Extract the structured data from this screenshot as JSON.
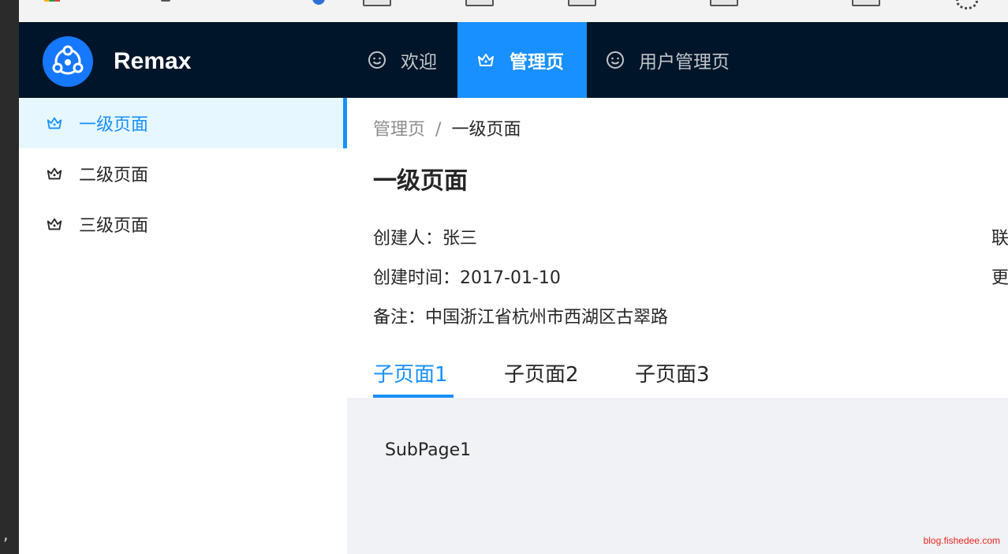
{
  "app": {
    "name": "Remax"
  },
  "top_nav": [
    {
      "label": "欢迎",
      "icon": "smile-icon",
      "active": false
    },
    {
      "label": "管理页",
      "icon": "crown-icon",
      "active": true
    },
    {
      "label": "用户管理页",
      "icon": "smile-icon",
      "active": false
    }
  ],
  "sidebar": {
    "items": [
      {
        "label": "一级页面",
        "icon": "crown-icon",
        "active": true
      },
      {
        "label": "二级页面",
        "icon": "crown-icon",
        "active": false
      },
      {
        "label": "三级页面",
        "icon": "crown-icon",
        "active": false
      }
    ]
  },
  "breadcrumb": {
    "parent": "管理页",
    "separator": "/",
    "current": "一级页面"
  },
  "page": {
    "title": "一级页面",
    "descriptions": [
      {
        "label": "创建人：",
        "value": "张三"
      },
      {
        "label": "创建时间：",
        "value": "2017-01-10"
      },
      {
        "label": "备注：",
        "value": "中国浙江省杭州市西湖区古翠路"
      }
    ],
    "right_column_clipped": [
      "联",
      "更"
    ]
  },
  "tabs": [
    {
      "label": "子页面1",
      "active": true
    },
    {
      "label": "子页面2",
      "active": false
    },
    {
      "label": "子页面3",
      "active": false
    }
  ],
  "tab_content": "SubPage1",
  "watermark": "blog.fishedee.com",
  "outer_left_glyph": ",",
  "colors": {
    "primary": "#1890ff",
    "header_bg": "#001529",
    "content_bg": "#f0f2f5"
  }
}
